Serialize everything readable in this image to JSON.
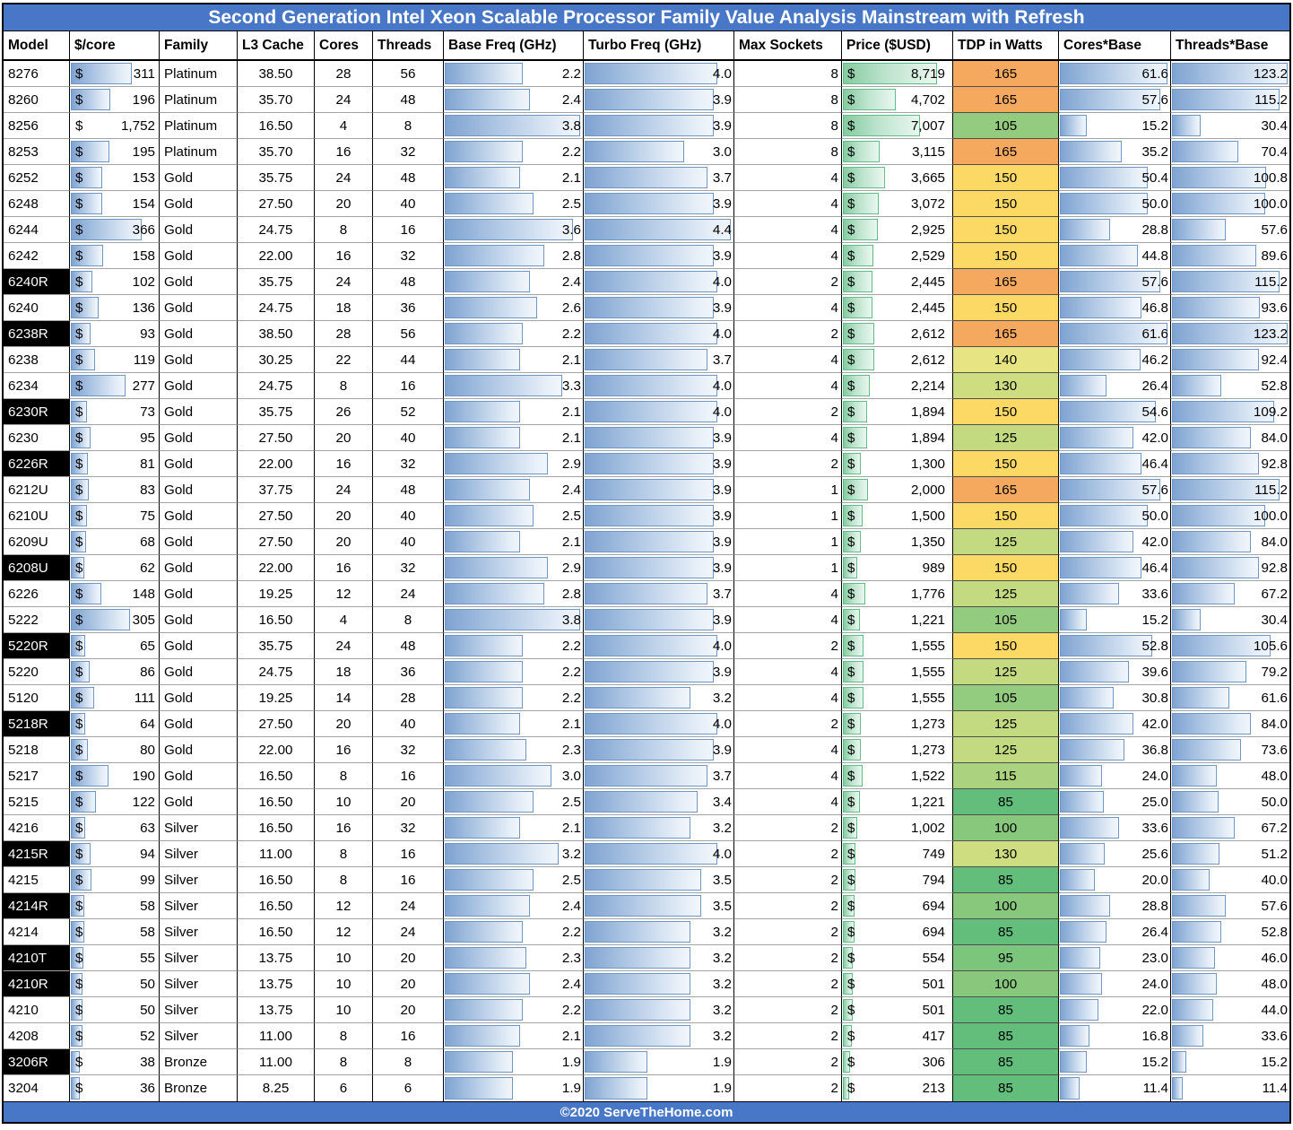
{
  "title": "Second Generation Intel Xeon Scalable Processor Family Value Analysis Mainstream with Refresh",
  "footer": "©2020 ServeTheHome.com",
  "colors": {
    "banner_blue": "#4777C6",
    "model_highlight_bg": "#000000",
    "model_highlight_text": "#ffffff",
    "bar_blue_border": "#6E96C6",
    "bar_blue_fill": "#7FA3D1",
    "bar_green_border": "#5FBE86",
    "bar_green_fill": "#85CBA0",
    "tdp_scale": {
      "85": "#63BE7B",
      "95": "#7BC57C",
      "100": "#87C87D",
      "105": "#93CC7E",
      "115": "#ABD37F",
      "125": "#C3DA80",
      "130": "#CFDD81",
      "140": "#E7E483",
      "150": "#FBD964",
      "165": "#F5A95F"
    }
  },
  "chart_data": {
    "type": "table",
    "columns": [
      "Model",
      "$/core",
      "Family",
      "L3 Cache",
      "Cores",
      "Threads",
      "Base Freq (GHz)",
      "Turbo Freq (GHz)",
      "Max Sockets",
      "Price ($USD)",
      "TDP in Watts",
      "Cores*Base",
      "Threads*Base"
    ],
    "row_fields": [
      "model",
      "highlighted",
      "dollar_per_core",
      "family",
      "l3_cache",
      "cores",
      "threads",
      "base_freq",
      "turbo_freq",
      "max_sockets",
      "price",
      "tdp_watts",
      "cores_x_base",
      "threads_x_base"
    ],
    "rows": [
      [
        "8276",
        0,
        "311",
        "Platinum",
        "38.50",
        "28",
        "56",
        "2.2",
        "4.0",
        "8",
        "8,719",
        165,
        "61.6",
        "123.2"
      ],
      [
        "8260",
        0,
        "196",
        "Platinum",
        "35.70",
        "24",
        "48",
        "2.4",
        "3.9",
        "8",
        "4,702",
        165,
        "57.6",
        "115.2"
      ],
      [
        "8256",
        0,
        "1,752",
        "Platinum",
        "16.50",
        "4",
        "8",
        "3.8",
        "3.9",
        "8",
        "7,007",
        105,
        "15.2",
        "30.4"
      ],
      [
        "8253",
        0,
        "195",
        "Platinum",
        "35.70",
        "16",
        "32",
        "2.2",
        "3.0",
        "8",
        "3,115",
        165,
        "35.2",
        "70.4"
      ],
      [
        "6252",
        0,
        "153",
        "Gold",
        "35.75",
        "24",
        "48",
        "2.1",
        "3.7",
        "4",
        "3,665",
        150,
        "50.4",
        "100.8"
      ],
      [
        "6248",
        0,
        "154",
        "Gold",
        "27.50",
        "20",
        "40",
        "2.5",
        "3.9",
        "4",
        "3,072",
        150,
        "50.0",
        "100.0"
      ],
      [
        "6244",
        0,
        "366",
        "Gold",
        "24.75",
        "8",
        "16",
        "3.6",
        "4.4",
        "4",
        "2,925",
        150,
        "28.8",
        "57.6"
      ],
      [
        "6242",
        0,
        "158",
        "Gold",
        "22.00",
        "16",
        "32",
        "2.8",
        "3.9",
        "4",
        "2,529",
        150,
        "44.8",
        "89.6"
      ],
      [
        "6240R",
        1,
        "102",
        "Gold",
        "35.75",
        "24",
        "48",
        "2.4",
        "4.0",
        "2",
        "2,445",
        165,
        "57.6",
        "115.2"
      ],
      [
        "6240",
        0,
        "136",
        "Gold",
        "24.75",
        "18",
        "36",
        "2.6",
        "3.9",
        "4",
        "2,445",
        150,
        "46.8",
        "93.6"
      ],
      [
        "6238R",
        1,
        "93",
        "Gold",
        "38.50",
        "28",
        "56",
        "2.2",
        "4.0",
        "2",
        "2,612",
        165,
        "61.6",
        "123.2"
      ],
      [
        "6238",
        0,
        "119",
        "Gold",
        "30.25",
        "22",
        "44",
        "2.1",
        "3.7",
        "4",
        "2,612",
        140,
        "46.2",
        "92.4"
      ],
      [
        "6234",
        0,
        "277",
        "Gold",
        "24.75",
        "8",
        "16",
        "3.3",
        "4.0",
        "4",
        "2,214",
        130,
        "26.4",
        "52.8"
      ],
      [
        "6230R",
        1,
        "73",
        "Gold",
        "35.75",
        "26",
        "52",
        "2.1",
        "4.0",
        "2",
        "1,894",
        150,
        "54.6",
        "109.2"
      ],
      [
        "6230",
        0,
        "95",
        "Gold",
        "27.50",
        "20",
        "40",
        "2.1",
        "3.9",
        "4",
        "1,894",
        125,
        "42.0",
        "84.0"
      ],
      [
        "6226R",
        1,
        "81",
        "Gold",
        "22.00",
        "16",
        "32",
        "2.9",
        "3.9",
        "2",
        "1,300",
        150,
        "46.4",
        "92.8"
      ],
      [
        "6212U",
        0,
        "83",
        "Gold",
        "37.75",
        "24",
        "48",
        "2.4",
        "3.9",
        "1",
        "2,000",
        165,
        "57.6",
        "115.2"
      ],
      [
        "6210U",
        0,
        "75",
        "Gold",
        "27.50",
        "20",
        "40",
        "2.5",
        "3.9",
        "1",
        "1,500",
        150,
        "50.0",
        "100.0"
      ],
      [
        "6209U",
        0,
        "68",
        "Gold",
        "27.50",
        "20",
        "40",
        "2.1",
        "3.9",
        "1",
        "1,350",
        125,
        "42.0",
        "84.0"
      ],
      [
        "6208U",
        1,
        "62",
        "Gold",
        "22.00",
        "16",
        "32",
        "2.9",
        "3.9",
        "1",
        "989",
        150,
        "46.4",
        "92.8"
      ],
      [
        "6226",
        0,
        "148",
        "Gold",
        "19.25",
        "12",
        "24",
        "2.8",
        "3.7",
        "4",
        "1,776",
        125,
        "33.6",
        "67.2"
      ],
      [
        "5222",
        0,
        "305",
        "Gold",
        "16.50",
        "4",
        "8",
        "3.8",
        "3.9",
        "4",
        "1,221",
        105,
        "15.2",
        "30.4"
      ],
      [
        "5220R",
        1,
        "65",
        "Gold",
        "35.75",
        "24",
        "48",
        "2.2",
        "4.0",
        "2",
        "1,555",
        150,
        "52.8",
        "105.6"
      ],
      [
        "5220",
        0,
        "86",
        "Gold",
        "24.75",
        "18",
        "36",
        "2.2",
        "3.9",
        "4",
        "1,555",
        125,
        "39.6",
        "79.2"
      ],
      [
        "5120",
        0,
        "111",
        "Gold",
        "19.25",
        "14",
        "28",
        "2.2",
        "3.2",
        "4",
        "1,555",
        105,
        "30.8",
        "61.6"
      ],
      [
        "5218R",
        1,
        "64",
        "Gold",
        "27.50",
        "20",
        "40",
        "2.1",
        "4.0",
        "2",
        "1,273",
        125,
        "42.0",
        "84.0"
      ],
      [
        "5218",
        0,
        "80",
        "Gold",
        "22.00",
        "16",
        "32",
        "2.3",
        "3.9",
        "4",
        "1,273",
        125,
        "36.8",
        "73.6"
      ],
      [
        "5217",
        0,
        "190",
        "Gold",
        "16.50",
        "8",
        "16",
        "3.0",
        "3.7",
        "4",
        "1,522",
        115,
        "24.0",
        "48.0"
      ],
      [
        "5215",
        0,
        "122",
        "Gold",
        "16.50",
        "10",
        "20",
        "2.5",
        "3.4",
        "4",
        "1,221",
        85,
        "25.0",
        "50.0"
      ],
      [
        "4216",
        0,
        "63",
        "Silver",
        "16.50",
        "16",
        "32",
        "2.1",
        "3.2",
        "2",
        "1,002",
        100,
        "33.6",
        "67.2"
      ],
      [
        "4215R",
        1,
        "94",
        "Silver",
        "11.00",
        "8",
        "16",
        "3.2",
        "4.0",
        "2",
        "749",
        130,
        "25.6",
        "51.2"
      ],
      [
        "4215",
        0,
        "99",
        "Silver",
        "16.50",
        "8",
        "16",
        "2.5",
        "3.5",
        "2",
        "794",
        85,
        "20.0",
        "40.0"
      ],
      [
        "4214R",
        1,
        "58",
        "Silver",
        "16.50",
        "12",
        "24",
        "2.4",
        "3.5",
        "2",
        "694",
        100,
        "28.8",
        "57.6"
      ],
      [
        "4214",
        0,
        "58",
        "Silver",
        "16.50",
        "12",
        "24",
        "2.2",
        "3.2",
        "2",
        "694",
        85,
        "26.4",
        "52.8"
      ],
      [
        "4210T",
        1,
        "55",
        "Silver",
        "13.75",
        "10",
        "20",
        "2.3",
        "3.2",
        "2",
        "554",
        95,
        "23.0",
        "46.0"
      ],
      [
        "4210R",
        1,
        "50",
        "Silver",
        "13.75",
        "10",
        "20",
        "2.4",
        "3.2",
        "2",
        "501",
        100,
        "24.0",
        "48.0"
      ],
      [
        "4210",
        0,
        "50",
        "Silver",
        "13.75",
        "10",
        "20",
        "2.2",
        "3.2",
        "2",
        "501",
        85,
        "22.0",
        "44.0"
      ],
      [
        "4208",
        0,
        "52",
        "Silver",
        "11.00",
        "8",
        "16",
        "2.1",
        "3.2",
        "2",
        "417",
        85,
        "16.8",
        "33.6"
      ],
      [
        "3206R",
        1,
        "38",
        "Bronze",
        "11.00",
        "8",
        "8",
        "1.9",
        "1.9",
        "2",
        "306",
        85,
        "15.2",
        "15.2"
      ],
      [
        "3204",
        0,
        "36",
        "Bronze",
        "8.25",
        "6",
        "6",
        "1.9",
        "1.9",
        "2",
        "213",
        85,
        "11.4",
        "11.4"
      ]
    ]
  }
}
